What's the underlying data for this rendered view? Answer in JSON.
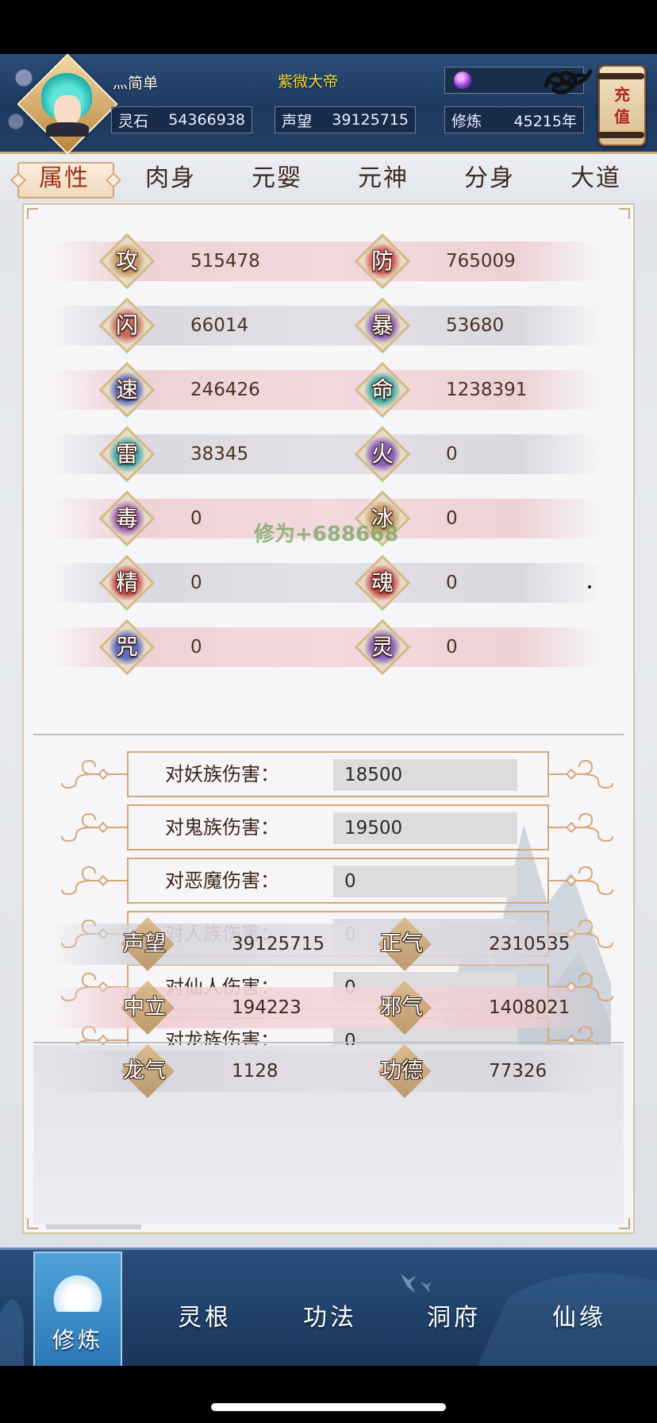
{
  "header": {
    "player_name": "灬简单",
    "title": "紫微大帝",
    "stats": [
      {
        "label": "灵石",
        "value": "54366938"
      },
      {
        "label": "声望",
        "value": "39125715"
      },
      {
        "label": "修炼",
        "value": "45215年"
      }
    ],
    "recharge_line1": "充",
    "recharge_line2": "值"
  },
  "tabs": [
    "属性",
    "肉身",
    "元婴",
    "元神",
    "分身",
    "大道"
  ],
  "active_tab": "属性",
  "attributes": [
    {
      "left": {
        "label": "攻",
        "value": "515478",
        "color": "#c49a63"
      },
      "right": {
        "label": "防",
        "value": "765009",
        "color": "#d35a5a"
      }
    },
    {
      "left": {
        "label": "闪",
        "value": "66014",
        "color": "#c96c60"
      },
      "right": {
        "label": "暴",
        "value": "53680",
        "color": "#8a63b8"
      }
    },
    {
      "left": {
        "label": "速",
        "value": "246426",
        "color": "#5f6dbd"
      },
      "right": {
        "label": "命",
        "value": "1238391",
        "color": "#3fa7a5"
      }
    },
    {
      "left": {
        "label": "雷",
        "value": "38345",
        "color": "#3fa7a5"
      },
      "right": {
        "label": "火",
        "value": "0",
        "color": "#8a63b8"
      }
    },
    {
      "left": {
        "label": "毒",
        "value": "0",
        "color": "#a262b4"
      },
      "right": {
        "label": "冰",
        "value": "0",
        "color": "#c49a63"
      }
    },
    {
      "left": {
        "label": "精",
        "value": "0",
        "color": "#c84b4b"
      },
      "right": {
        "label": "魂",
        "value": "0",
        "color": "#c84b4b"
      }
    },
    {
      "left": {
        "label": "咒",
        "value": "0",
        "color": "#5f6dbd"
      },
      "right": {
        "label": "灵",
        "value": "0",
        "color": "#8a63b8"
      }
    }
  ],
  "floating_text": "修为+688668",
  "damage": [
    {
      "label": "对妖族伤害：",
      "value": "18500"
    },
    {
      "label": "对鬼族伤害：",
      "value": "19500"
    },
    {
      "label": "对恶魔伤害：",
      "value": "0"
    },
    {
      "label": "对人族伤害：",
      "value": "0"
    },
    {
      "label": "对仙人伤害：",
      "value": "0"
    },
    {
      "label": "对龙族伤害：",
      "value": "0"
    }
  ],
  "reputation": [
    {
      "left": {
        "label": "声望",
        "value": "39125715"
      },
      "right": {
        "label": "正气",
        "value": "2310535"
      }
    },
    {
      "left": {
        "label": "中立",
        "value": "194223"
      },
      "right": {
        "label": "邪气",
        "value": "1408021"
      }
    },
    {
      "left": {
        "label": "龙气",
        "value": "1128"
      },
      "right": {
        "label": "功德",
        "value": "77326"
      }
    }
  ],
  "bottom_nav": {
    "active": "修炼",
    "items": [
      "灵根",
      "功法",
      "洞府",
      "仙缘"
    ]
  },
  "colors": {
    "header_bg": "#1e3a60",
    "title_yellow": "#f0e040",
    "active_tab_text": "#9b3416",
    "nav_bg": "#1f3f67"
  }
}
